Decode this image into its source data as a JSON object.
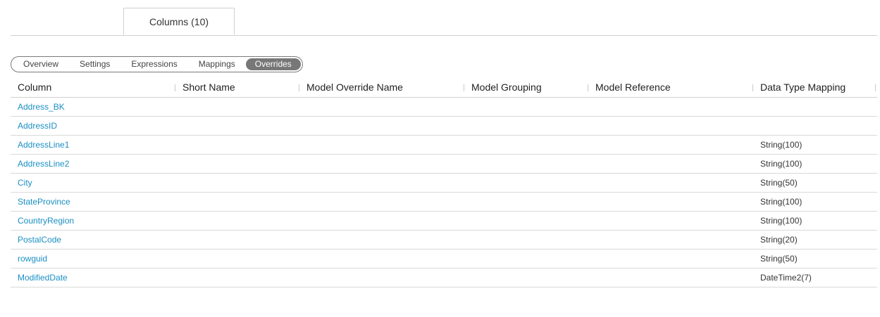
{
  "tabs": [
    {
      "label": "Columns (10)"
    }
  ],
  "segments": [
    "Overview",
    "Settings",
    "Expressions",
    "Mappings",
    "Overrides"
  ],
  "active_segment": "Overrides",
  "table": {
    "headers": [
      "Column",
      "Short Name",
      "Model Override Name",
      "Model Grouping",
      "Model Reference",
      "Data Type Mapping"
    ],
    "rows": [
      {
        "column": "Address_BK",
        "short_name": "",
        "model_override_name": "",
        "model_grouping": "",
        "model_reference": "",
        "data_type_mapping": ""
      },
      {
        "column": "AddressID",
        "short_name": "",
        "model_override_name": "",
        "model_grouping": "",
        "model_reference": "",
        "data_type_mapping": ""
      },
      {
        "column": "AddressLine1",
        "short_name": "",
        "model_override_name": "",
        "model_grouping": "",
        "model_reference": "",
        "data_type_mapping": "String(100)"
      },
      {
        "column": "AddressLine2",
        "short_name": "",
        "model_override_name": "",
        "model_grouping": "",
        "model_reference": "",
        "data_type_mapping": "String(100)"
      },
      {
        "column": "City",
        "short_name": "",
        "model_override_name": "",
        "model_grouping": "",
        "model_reference": "",
        "data_type_mapping": "String(50)"
      },
      {
        "column": "StateProvince",
        "short_name": "",
        "model_override_name": "",
        "model_grouping": "",
        "model_reference": "",
        "data_type_mapping": "String(100)"
      },
      {
        "column": "CountryRegion",
        "short_name": "",
        "model_override_name": "",
        "model_grouping": "",
        "model_reference": "",
        "data_type_mapping": "String(100)"
      },
      {
        "column": "PostalCode",
        "short_name": "",
        "model_override_name": "",
        "model_grouping": "",
        "model_reference": "",
        "data_type_mapping": "String(20)"
      },
      {
        "column": "rowguid",
        "short_name": "",
        "model_override_name": "",
        "model_grouping": "",
        "model_reference": "",
        "data_type_mapping": "String(50)"
      },
      {
        "column": "ModifiedDate",
        "short_name": "",
        "model_override_name": "",
        "model_grouping": "",
        "model_reference": "",
        "data_type_mapping": "DateTime2(7)"
      }
    ]
  },
  "colors": {
    "link": "#1a8fc4",
    "active_segment_bg": "#777777",
    "border": "#d0d0d0"
  }
}
